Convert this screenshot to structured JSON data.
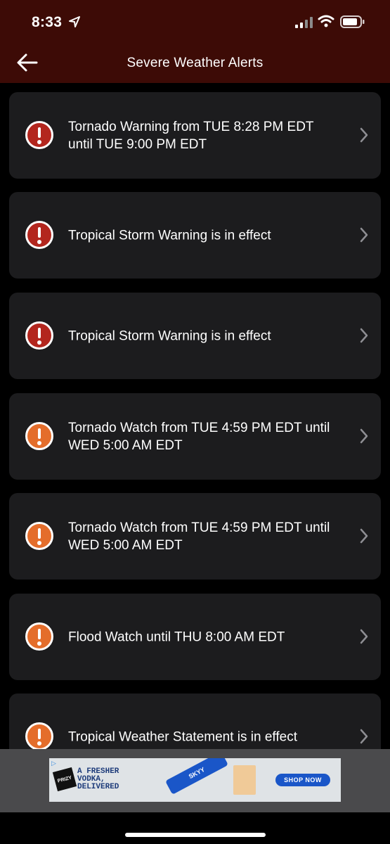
{
  "status_bar": {
    "time": "8:33",
    "icons": [
      "location-arrow-icon",
      "cellular-signal-icon",
      "wifi-icon",
      "battery-icon"
    ]
  },
  "nav": {
    "title": "Severe Weather Alerts",
    "back_icon": "arrow-left-icon"
  },
  "colors": {
    "header_bg": "#3d0b06",
    "card_bg": "#1c1c1e",
    "warning_red": "#b3261e",
    "watch_orange": "#e46d2b",
    "chevron": "#8e8e93"
  },
  "alerts": [
    {
      "text": "Tornado Warning from TUE 8:28 PM EDT until TUE 9:00 PM EDT",
      "severity": "warning",
      "icon": "exclamation-circle-icon"
    },
    {
      "text": "Tropical Storm Warning is in effect",
      "severity": "warning",
      "icon": "exclamation-circle-icon"
    },
    {
      "text": "Tropical Storm Warning is in effect",
      "severity": "warning",
      "icon": "exclamation-circle-icon"
    },
    {
      "text": "Tornado Watch from TUE 4:59 PM EDT until WED 5:00 AM EDT",
      "severity": "watch",
      "icon": "exclamation-circle-icon"
    },
    {
      "text": "Tornado Watch from TUE 4:59 PM EDT until WED 5:00 AM EDT",
      "severity": "watch",
      "icon": "exclamation-circle-icon"
    },
    {
      "text": "Flood Watch until THU 8:00 AM EDT",
      "severity": "watch",
      "icon": "exclamation-circle-icon"
    },
    {
      "text": "Tropical Weather Statement is in effect",
      "severity": "watch",
      "icon": "exclamation-circle-icon"
    }
  ],
  "ad": {
    "brand": "PRIZY",
    "headline": "A FRESHER VODKA, DELIVERED",
    "bottle_label": "SKYY",
    "cta": "SHOP NOW"
  }
}
